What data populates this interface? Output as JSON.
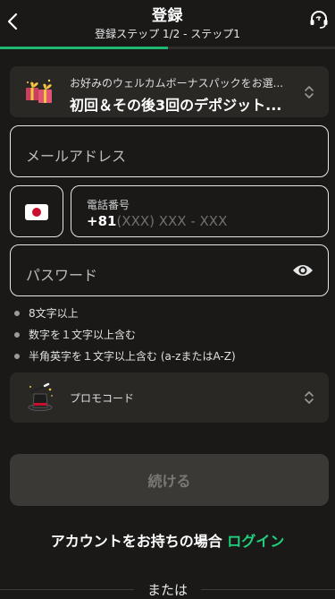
{
  "header": {
    "title": "登録",
    "subtitle": "登録ステップ 1/2 - ステップ1",
    "progress": 0.5,
    "back_icon": "chevron-left-icon",
    "support_icon": "headset-icon",
    "accent_color": "#1fb872"
  },
  "bonus": {
    "line1": "お好みのウェルカムボーナスパックをお選...",
    "line2": "初回＆その後3回のデポジット..."
  },
  "form": {
    "email_placeholder": "メールアドレス",
    "phone_label": "電話番号",
    "phone_code": "+81",
    "phone_mask": "(XXX) XXX - XXX",
    "password_placeholder": "パスワード",
    "country_flag": "japan-flag"
  },
  "requirements": [
    "8文字以上",
    "数字を１文字以上含む",
    "半角英字を１文字以上含む (a-zまたはA-Z)"
  ],
  "promo": {
    "label": "プロモコード"
  },
  "continue_label": "続ける",
  "login": {
    "prefix": "アカウントをお持ちの場合",
    "link": "ログイン",
    "link_color": "#1fd17d"
  },
  "or_text": "または"
}
